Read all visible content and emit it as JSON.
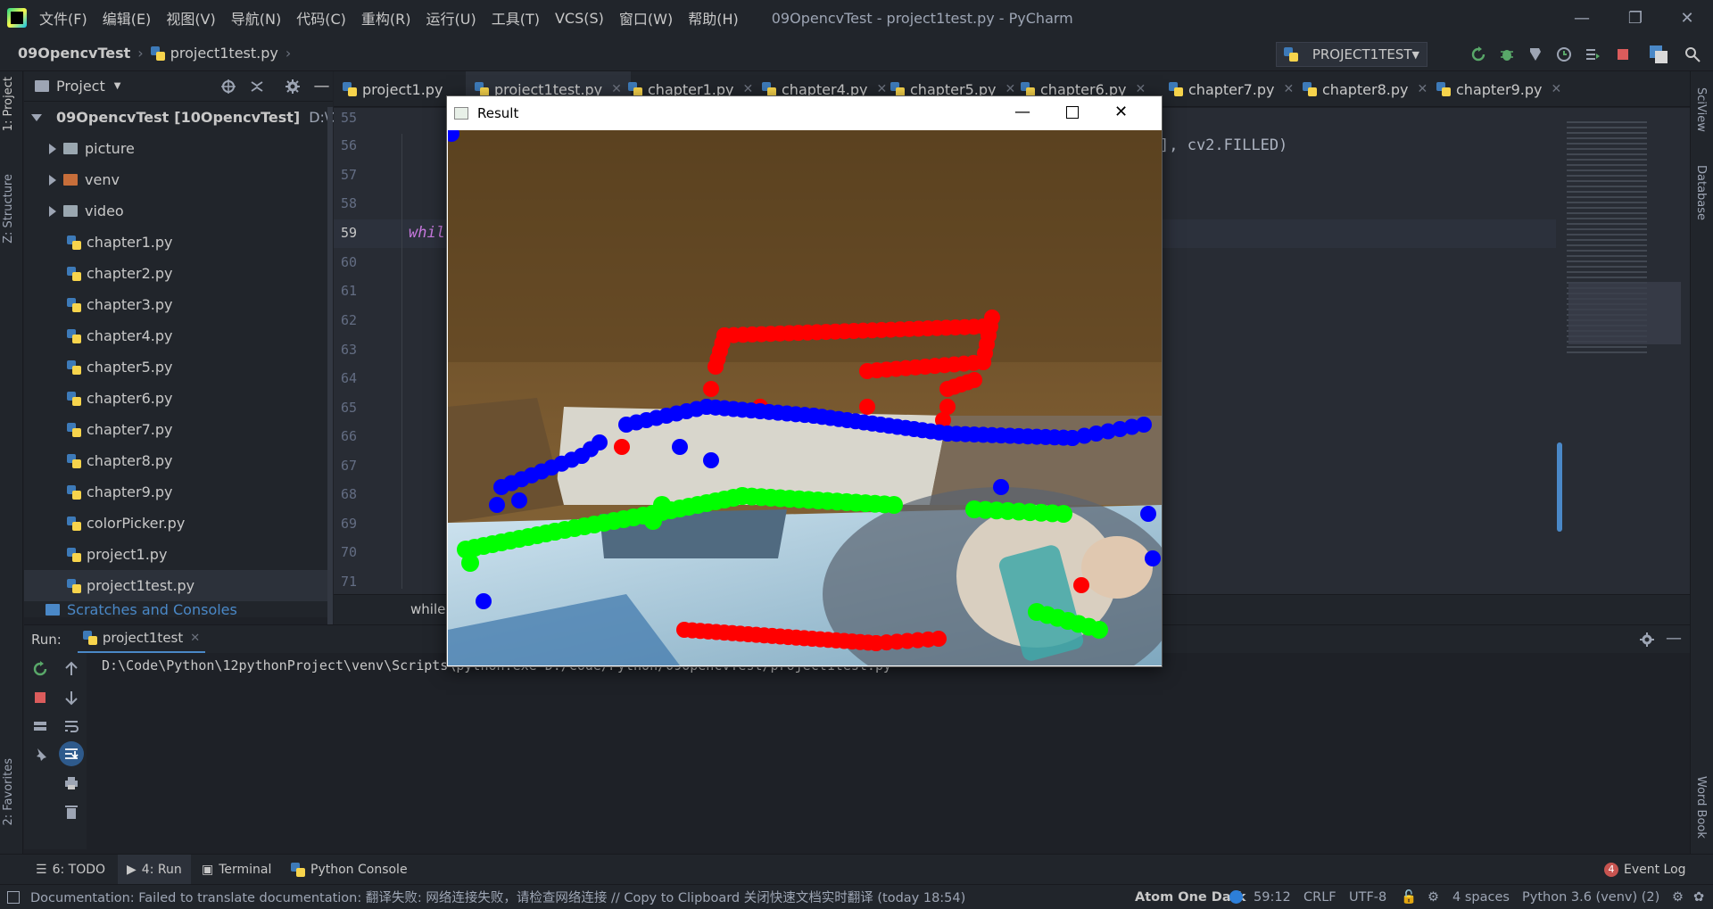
{
  "titlebar": {
    "menus": [
      "文件(F)",
      "编辑(E)",
      "视图(V)",
      "导航(N)",
      "代码(C)",
      "重构(R)",
      "运行(U)",
      "工具(T)",
      "VCS(S)",
      "窗口(W)",
      "帮助(H)"
    ],
    "window_title": "09OpencvTest - project1test.py - PyCharm",
    "minimize": "—",
    "restore": "❐",
    "close": "✕"
  },
  "navbar": {
    "project": "09OpencvTest",
    "file": "project1test.py",
    "run_config": "PROJECT1TEST"
  },
  "left_stripe": {
    "project_tab": "1: Project",
    "structure_tab": "Z: Structure",
    "favorites_tab": "2: Favorites"
  },
  "right_stripe": {
    "sciview": "SciView",
    "database": "Database",
    "wordbook": "Word Book"
  },
  "project_panel": {
    "title": "Project",
    "root_name": "09OpencvTest",
    "root_module": "[10OpencvTest]",
    "root_path": "D:\\Code\\",
    "folders": [
      "picture",
      "venv",
      "video"
    ],
    "files": [
      "chapter1.py",
      "chapter2.py",
      "chapter3.py",
      "chapter4.py",
      "chapter5.py",
      "chapter6.py",
      "chapter7.py",
      "chapter8.py",
      "chapter9.py",
      "colorPicker.py",
      "project1.py",
      "project1test.py"
    ],
    "scratches": "Scratches and Consoles"
  },
  "editor": {
    "tabs": [
      "project1.py",
      "project1test.py",
      "chapter1.py",
      "chapter4.py",
      "chapter5.py",
      "chapter6.py",
      "chapter7.py",
      "chapter8.py",
      "chapter9.py"
    ],
    "active_tab": "project1test.py",
    "line_numbers": [
      "55",
      "56",
      "57",
      "58",
      "59",
      "60",
      "61",
      "62",
      "63",
      "64",
      "65",
      "66",
      "67",
      "68",
      "69",
      "70",
      "71"
    ],
    "current_line": "59",
    "code_line_56": "], cv2.FILLED)",
    "code_line_59": "whil",
    "bottom_breadcrumb": "while"
  },
  "run_panel": {
    "label": "Run:",
    "tab": "project1test",
    "output": "D:\\Code\\Python\\12pythonProject\\venv\\Scripts\\python.exe D:/Code/Python/09OpencvTest/project1test.py"
  },
  "toolwindows": {
    "todo": "6: TODO",
    "run": "4: Run",
    "terminal": "Terminal",
    "python_console": "Python Console",
    "event_log": "Event Log",
    "event_count": "4"
  },
  "statusbar": {
    "message": "Documentation: Failed to translate documentation: 翻译失败: 网络连接失败，请检查网络连接 // Copy to Clipboard   关闭快速文档实时翻译 (today 18:54)",
    "theme": "Atom One Dark",
    "position": "59:12",
    "line_sep": "CRLF",
    "encoding": "UTF-8",
    "indent": "4 spaces",
    "interpreter": "Python 3.6 (venv) (2)"
  },
  "result_window": {
    "title": "Result"
  },
  "colors": {
    "red_dot": "#ff0000",
    "blue_dot": "#0000ff",
    "green_dot": "#00ff00",
    "accent": "#4a88c7"
  }
}
